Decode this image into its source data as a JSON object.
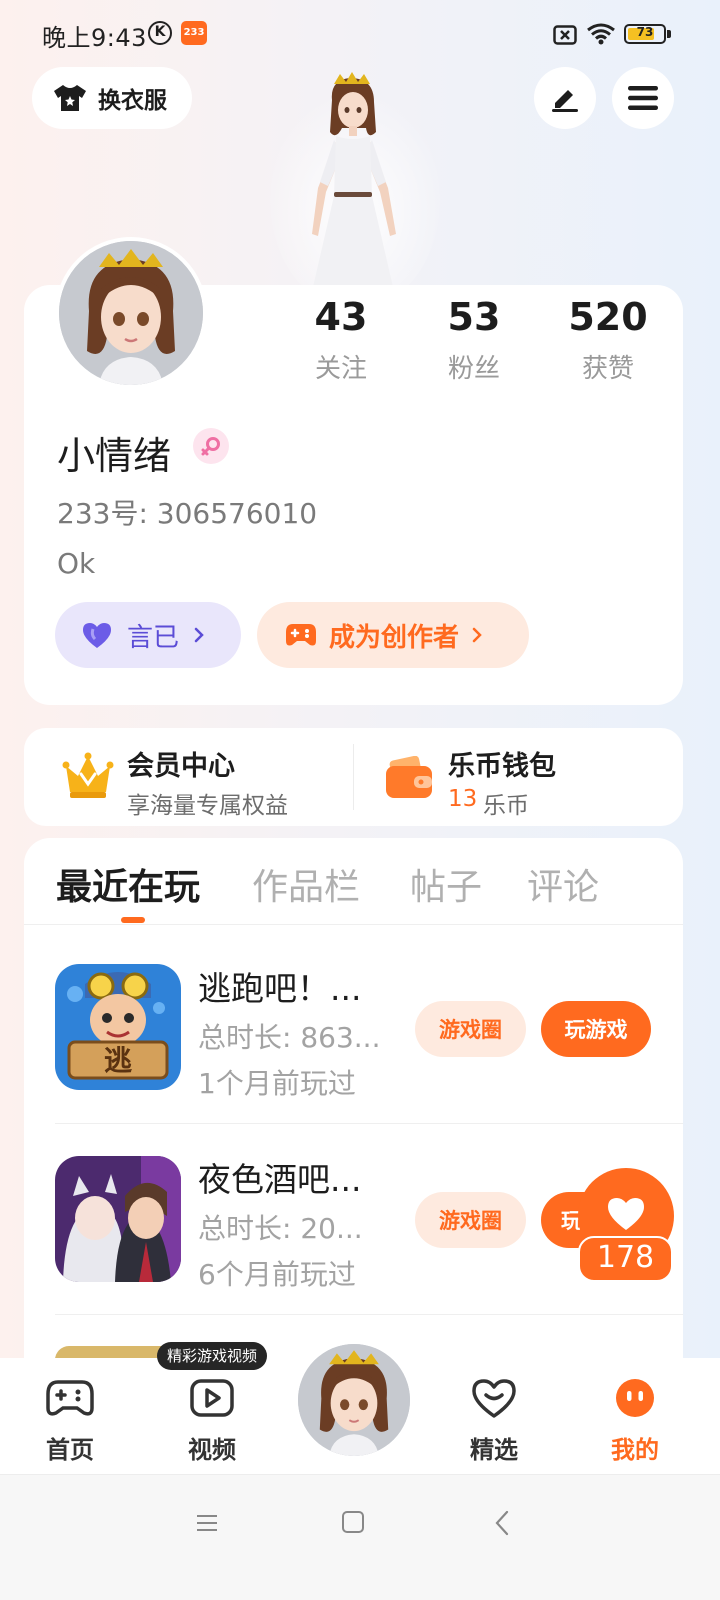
{
  "status_bar": {
    "time": "晚上9:43",
    "k_badge": "K",
    "app_badge": "233",
    "battery": "73"
  },
  "header": {
    "outfit_label": "换衣服"
  },
  "profile": {
    "stats": [
      {
        "value": "43",
        "label": "关注"
      },
      {
        "value": "53",
        "label": "粉丝"
      },
      {
        "value": "520",
        "label": "获赞"
      }
    ],
    "name": "小情绪",
    "id_text": "233号: 306576010",
    "bio": "Ok",
    "tag_purple": "言已",
    "tag_orange": "成为创作者"
  },
  "perks": {
    "member_title": "会员中心",
    "member_sub": "享海量专属权益",
    "wallet_title": "乐币钱包",
    "wallet_amount": "13",
    "wallet_unit": "乐币"
  },
  "tabs": [
    "最近在玩",
    "作品栏",
    "帖子",
    "评论"
  ],
  "games": [
    {
      "title": "逃跑吧！...",
      "duration": "总时长: 863...",
      "last_played": "1个月前玩过",
      "circle_label": "游戏圈",
      "play_label": "玩游戏",
      "icon_text": "逃"
    },
    {
      "title": "夜色酒吧...",
      "duration": "总时长: 20...",
      "last_played": "6个月前玩过",
      "circle_label": "游戏圈",
      "play_label": "玩游戏"
    }
  ],
  "like": {
    "count": "178"
  },
  "bottom_nav": {
    "home": "首页",
    "video": "视频",
    "video_tooltip": "精彩游戏视频",
    "featured": "精选",
    "mine": "我的"
  },
  "colors": {
    "accent": "#ff6a1f",
    "purple": "#5b4cd6"
  }
}
